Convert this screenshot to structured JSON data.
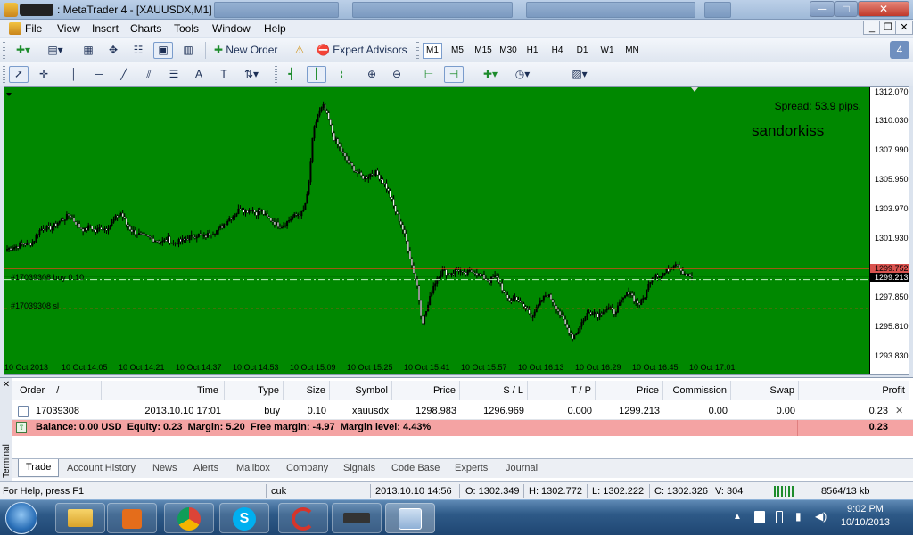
{
  "window": {
    "title": ": MetaTrader 4 - [XAUUSDX,M1]",
    "min_glyph": "─",
    "max_glyph": "□",
    "close_glyph": "✕"
  },
  "menu": [
    "File",
    "View",
    "Insert",
    "Charts",
    "Tools",
    "Window",
    "Help"
  ],
  "mdi": {
    "min_glyph": "_",
    "restore_glyph": "❐",
    "close_glyph": "✕"
  },
  "toolbar": {
    "new_order": "New Order",
    "expert_advisors": "Expert Advisors",
    "badge": "4"
  },
  "timeframes": [
    "M1",
    "M5",
    "M15",
    "M30",
    "H1",
    "H4",
    "D1",
    "W1",
    "MN"
  ],
  "selected_timeframe": "M1",
  "chart": {
    "spread": "Spread: 53.9 pips.",
    "watermark": "sandorkiss",
    "buy_label": "#17039308 buy 0.10",
    "sl_label": "#17039308 sl",
    "ask_label": "1299.752",
    "bid_label": "1299.213",
    "bg_color": "#008800"
  },
  "chart_data": {
    "type": "candlestick",
    "price_ticks": [
      "1312.070",
      "1310.030",
      "1307.990",
      "1305.950",
      "1303.970",
      "1301.930",
      "1299.752",
      "1299.213",
      "1297.850",
      "1295.810",
      "1293.830"
    ],
    "time_ticks": [
      "10 Oct 2013",
      "10 Oct 14:05",
      "10 Oct 14:21",
      "10 Oct 14:37",
      "10 Oct 14:53",
      "10 Oct 15:09",
      "10 Oct 15:25",
      "10 Oct 15:41",
      "10 Oct 15:57",
      "10 Oct 16:13",
      "10 Oct 16:29",
      "10 Oct 16:45",
      "10 Oct 17:01"
    ],
    "ylim": [
      1293.4,
      1312.3
    ],
    "buy_price": 1298.983,
    "sl_price": 1296.969,
    "ask": 1299.752,
    "bid": 1299.213,
    "close_path": [
      1301.1,
      1301.2,
      1301.3,
      1301.5,
      1301.4,
      1301.6,
      1302.3,
      1302.6,
      1302.5,
      1302.7,
      1303.0,
      1303.2,
      1303.5,
      1303.0,
      1302.6,
      1302.4,
      1302.7,
      1302.3,
      1302.6,
      1302.5,
      1302.8,
      1303.3,
      1303.6,
      1302.8,
      1302.4,
      1302.2,
      1302.0,
      1301.9,
      1301.8,
      1301.7,
      1301.6,
      1301.8,
      1301.5,
      1301.6,
      1301.7,
      1301.9,
      1302.0,
      1302.1,
      1301.9,
      1302.2,
      1302.3,
      1302.5,
      1302.9,
      1303.3,
      1303.5,
      1304.0,
      1303.7,
      1303.9,
      1303.6,
      1303.8,
      1303.3,
      1303.1,
      1302.8,
      1302.7,
      1303.0,
      1303.3,
      1303.5,
      1303.6,
      1305.0,
      1309.2,
      1310.5,
      1311.0,
      1310.0,
      1308.8,
      1308.2,
      1307.5,
      1307.0,
      1306.6,
      1306.2,
      1306.0,
      1306.3,
      1306.4,
      1306.0,
      1305.5,
      1304.6,
      1303.6,
      1302.8,
      1301.6,
      1300.0,
      1298.7,
      1296.0,
      1297.0,
      1298.4,
      1299.2,
      1299.6,
      1299.4,
      1299.5,
      1299.7,
      1299.3,
      1299.5,
      1299.6,
      1299.3,
      1299.1,
      1298.9,
      1299.2,
      1298.8,
      1297.8,
      1297.5,
      1297.8,
      1297.3,
      1297.0,
      1296.5,
      1296.9,
      1297.5,
      1298.0,
      1297.6,
      1297.0,
      1296.3,
      1295.6,
      1295.0,
      1295.4,
      1296.2,
      1296.7,
      1296.8,
      1296.5,
      1296.9,
      1297.0,
      1296.7,
      1297.2,
      1297.8,
      1298.2,
      1297.5,
      1297.3,
      1297.9,
      1299.0,
      1299.4,
      1299.2,
      1299.5,
      1299.9,
      1300.2,
      1299.6,
      1299.3,
      1299.2
    ]
  },
  "terminal": {
    "side_label": "Terminal",
    "columns": [
      "Order",
      "/",
      "Time",
      "Type",
      "Size",
      "Symbol",
      "Price",
      "S / L",
      "T / P",
      "Price",
      "Commission",
      "Swap",
      "Profit"
    ],
    "row": {
      "order": "17039308",
      "time": "2013.10.10 17:01",
      "type": "buy",
      "size": "0.10",
      "symbol": "xauusdx",
      "price": "1298.983",
      "sl": "1296.969",
      "tp": "0.000",
      "cur_price": "1299.213",
      "commission": "0.00",
      "swap": "0.00",
      "profit": "0.23",
      "close_glyph": "✕"
    },
    "balance_text": "Balance: 0.00 USD  Equity: 0.23  Margin: 5.20  Free margin: -4.97  Margin level: 4.43%",
    "balance_profit": "0.23",
    "tabs": [
      "Trade",
      "Account History",
      "News",
      "Alerts",
      "Mailbox",
      "Company",
      "Signals",
      "Code Base",
      "Experts",
      "Journal"
    ],
    "active_tab": "Trade"
  },
  "status": {
    "help": "For Help, press F1",
    "profile": "cuk",
    "datetime": "2013.10.10 14:56",
    "open": "O: 1302.349",
    "high": "H: 1302.772",
    "low": "L: 1302.222",
    "close": "C: 1302.326",
    "volume": "V: 304",
    "traffic": "8564/13 kb"
  },
  "taskbar": {
    "time": "9:02 PM",
    "date": "10/10/2013"
  }
}
